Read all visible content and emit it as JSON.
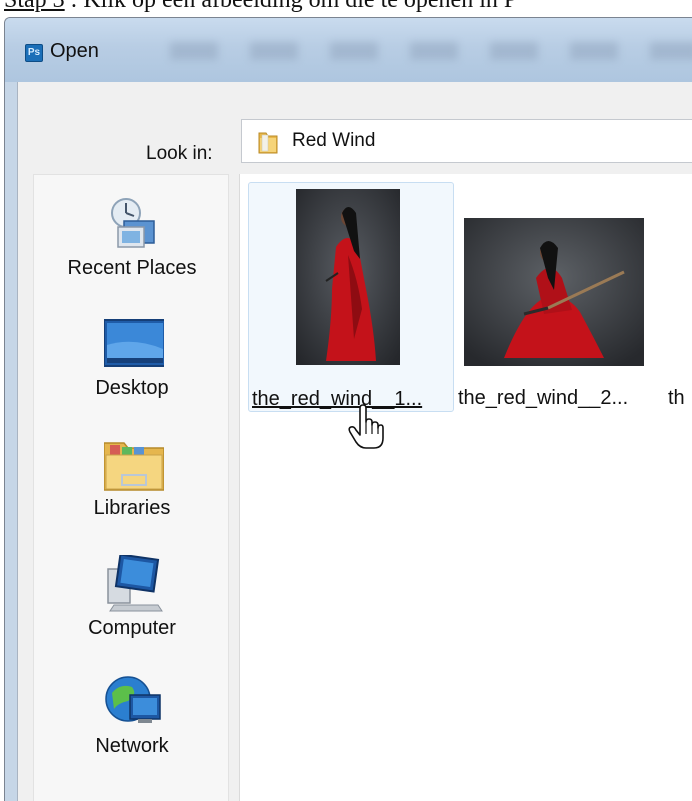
{
  "caption": {
    "step": "Stap 3",
    "text": " : Klik op een afbeelding om die te openen in P"
  },
  "window": {
    "app_icon_text": "Ps",
    "title": "Open"
  },
  "look_in": {
    "label": "Look in:",
    "value": "Red Wind"
  },
  "places": [
    {
      "label": "Recent Places",
      "icon": "recent-places-icon"
    },
    {
      "label": "Desktop",
      "icon": "desktop-icon"
    },
    {
      "label": "Libraries",
      "icon": "libraries-icon"
    },
    {
      "label": "Computer",
      "icon": "computer-icon"
    },
    {
      "label": "Network",
      "icon": "network-icon"
    }
  ],
  "files": [
    {
      "name": "the_red_wind__1...",
      "selected": true
    },
    {
      "name": "the_red_wind__2...",
      "selected": false
    },
    {
      "name": "th",
      "selected": false
    }
  ],
  "colors": {
    "title_bar": "#b8cde4",
    "dress_red": "#c4121a",
    "selection_border": "#c8def2"
  }
}
